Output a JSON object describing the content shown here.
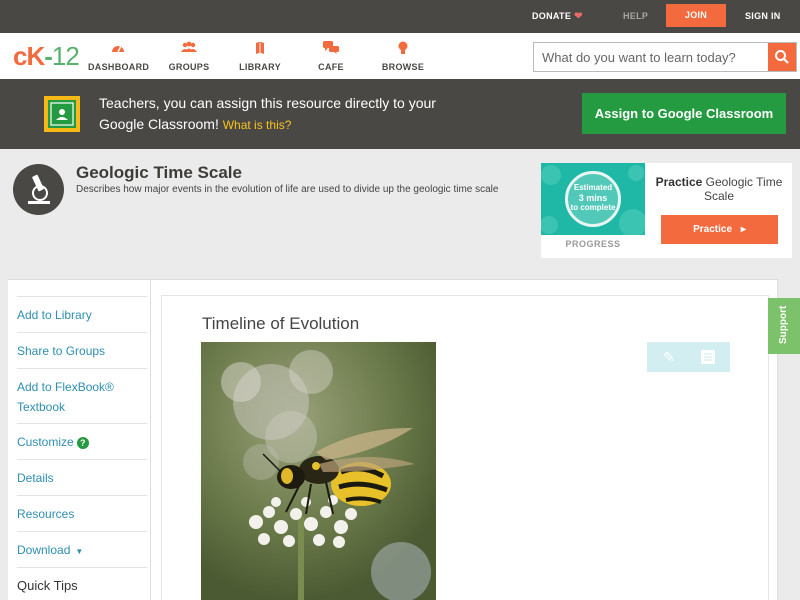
{
  "topbar": {
    "donate": "DONATE",
    "help": "HELP",
    "join": "JOIN",
    "signin": "SIGN IN"
  },
  "logo": {
    "c": "c",
    "k": "K",
    "dash": "-",
    "num": "12"
  },
  "nav": {
    "dashboard": "DASHBOARD",
    "groups": "GROUPS",
    "library": "LIBRARY",
    "cafe": "CAFE",
    "browse": "BROWSE"
  },
  "search": {
    "placeholder": "What do you want to learn today?"
  },
  "classroom_banner": {
    "text": "Teachers, you can assign this resource directly to your Google Classroom!",
    "link": "What is this?",
    "button": "Assign to Google Classroom"
  },
  "resource": {
    "title": "Geologic Time Scale",
    "description": "Describes how major events in the evolution of life are used to divide up the geologic time scale"
  },
  "practice": {
    "estimate_line1": "Estimated",
    "estimate_line2": "3 mins",
    "estimate_line3": "to complete",
    "progress_label": "PROGRESS",
    "name_bold": "Practice",
    "name": "Geologic Time Scale",
    "button": "Practice"
  },
  "sidebar": {
    "add_library": "Add to Library",
    "share_groups": "Share to Groups",
    "add_flexbook": "Add to FlexBook®",
    "add_flexbook_2": "Textbook",
    "customize": "Customize",
    "details": "Details",
    "resources": "Resources",
    "download": "Download",
    "quick_tips": "Quick Tips"
  },
  "article": {
    "title": "Timeline of Evolution"
  },
  "support": "Support",
  "colors": {
    "brand_orange": "#f26a3d",
    "brand_green": "#57b26b",
    "classroom_green": "#249a41",
    "dark_bar": "#4a4844",
    "link_blue": "#2e8fb1"
  }
}
